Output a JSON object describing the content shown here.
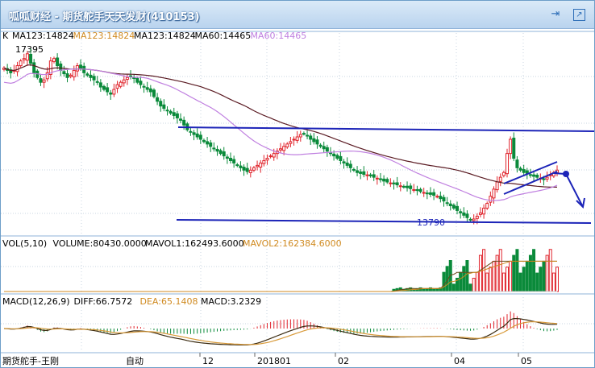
{
  "window": {
    "title": "呱呱财经 - 期货舵手天天发财(410153)",
    "pin_icon": "pin-icon",
    "restore_icon": "restore-icon"
  },
  "colors": {
    "up": "#e0242c",
    "down": "#0a8a3a",
    "ma123": "#5a1a22",
    "ma60": "#c080e0",
    "trend": "#1c24b8",
    "mavol1": "#6a4a1a",
    "mavol2": "#d08a20",
    "diff": "#3a2a10",
    "dea": "#d89a3a",
    "grid": "#c8d4e2"
  },
  "main": {
    "period_label": "K",
    "ma_legend": [
      {
        "text": "MA123:14824",
        "color": "#000000"
      },
      {
        "text": "MA123:14824",
        "color": "#d08a20"
      },
      {
        "text": "MA123:14824",
        "color": "#000000"
      },
      {
        "text": "MA60:14465",
        "color": "#000000"
      },
      {
        "text": "MA60:14465",
        "color": "#c080e0"
      }
    ],
    "high_label": "17395",
    "low_label": "13790"
  },
  "vol": {
    "legend": [
      {
        "text": "VOL(5,10)",
        "color": "#000000"
      },
      {
        "text": "VOLUME:80430.0000",
        "color": "#000000"
      },
      {
        "text": "MAVOL1:162493.6000",
        "color": "#000000"
      },
      {
        "text": "MAVOL2:162384.6000",
        "color": "#d08a20"
      }
    ]
  },
  "macd": {
    "legend": [
      {
        "text": "MACD(12,26,9)",
        "color": "#000000"
      },
      {
        "text": "DIFF:66.7572",
        "color": "#000000"
      },
      {
        "text": "DEA:65.1408",
        "color": "#d08a20"
      },
      {
        "text": "MACD:3.2329",
        "color": "#000000"
      }
    ]
  },
  "footer": {
    "left_text": "期货舵手-王刚",
    "mid_text": "自动",
    "x_labels": [
      "12",
      "201801",
      "02",
      "04",
      "05"
    ]
  },
  "chart_data": {
    "type": "candlestick",
    "price_high": 17395,
    "price_low": 13790,
    "ma123_last": 14824,
    "ma60_last": 14465,
    "volume_last": 80430,
    "mavol1_last": 162493.6,
    "mavol2_last": 162384.6,
    "diff_last": 66.7572,
    "dea_last": 65.1408,
    "macd_last": 3.2329,
    "x_tick_labels": [
      "12",
      "201801",
      "02",
      "04",
      "05"
    ],
    "close_path": [
      17000,
      16950,
      16900,
      16950,
      17050,
      17150,
      17200,
      17300,
      17100,
      16900,
      16800,
      16700,
      16750,
      16900,
      17150,
      17200,
      17050,
      16950,
      16880,
      16800,
      16850,
      16950,
      17050,
      17000,
      16900,
      16850,
      16800,
      16750,
      16700,
      16600,
      16550,
      16500,
      16450,
      16550,
      16650,
      16700,
      16750,
      16800,
      16820,
      16780,
      16700,
      16650,
      16600,
      16550,
      16500,
      16400,
      16300,
      16200,
      16150,
      16100,
      16050,
      16000,
      15950,
      15900,
      15800,
      15700,
      15650,
      15600,
      15550,
      15500,
      15450,
      15400,
      15350,
      15300,
      15250,
      15200,
      15150,
      15100,
      15050,
      15000,
      14950,
      14900,
      14850,
      14820,
      14850,
      14900,
      14950,
      15000,
      15050,
      15100,
      15150,
      15200,
      15250,
      15300,
      15350,
      15400,
      15450,
      15500,
      15550,
      15600,
      15620,
      15580,
      15500,
      15450,
      15400,
      15350,
      15300,
      15250,
      15200,
      15150,
      15100,
      15050,
      15000,
      14950,
      14900,
      14850,
      14800,
      14780,
      14760,
      14750,
      14730,
      14700,
      14680,
      14650,
      14620,
      14600,
      14580,
      14560,
      14540,
      14520,
      14500,
      14480,
      14460,
      14440,
      14420,
      14400,
      14380,
      14360,
      14340,
      14320,
      14300,
      14250,
      14200,
      14150,
      14100,
      14050,
      14000,
      13950,
      13900,
      13850,
      13800,
      13820,
      13880,
      13950,
      14050,
      14150,
      14300,
      14450,
      14600,
      14700,
      14800,
      15200,
      15500,
      15100,
      14900,
      14850,
      14800,
      14780,
      14750,
      14720,
      14700,
      14680,
      14650,
      14700,
      14750,
      14800,
      14850
    ]
  }
}
